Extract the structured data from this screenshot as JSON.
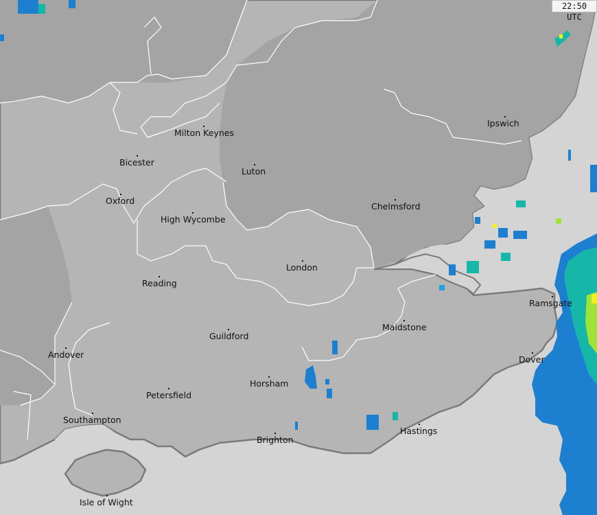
{
  "timestamp": "22:50 UTC",
  "colors": {
    "sea": "#d4d4d4",
    "land_light": "#b5b5b5",
    "land_dark": "#a4a4a4",
    "coast": "#7a7a7a",
    "border": "#ffffff",
    "radar_light": "#2aa0d8",
    "radar_medium": "#1d7fd0",
    "radar_heavy": "#16b7a8",
    "radar_intense": "#9ee23a",
    "radar_extreme": "#f0f020"
  },
  "cities": [
    {
      "name": "Milton Keynes"
    },
    {
      "name": "Bicester"
    },
    {
      "name": "Luton"
    },
    {
      "name": "Ipswich"
    },
    {
      "name": "Oxford"
    },
    {
      "name": "Chelmsford"
    },
    {
      "name": "High Wycombe"
    },
    {
      "name": "London"
    },
    {
      "name": "Reading"
    },
    {
      "name": "Ramsgate"
    },
    {
      "name": "Maidstone"
    },
    {
      "name": "Guildford"
    },
    {
      "name": "Andover"
    },
    {
      "name": "Dover"
    },
    {
      "name": "Horsham"
    },
    {
      "name": "Petersfield"
    },
    {
      "name": "Southampton"
    },
    {
      "name": "Hastings"
    },
    {
      "name": "Brighton"
    },
    {
      "name": "Isle of Wight"
    }
  ]
}
